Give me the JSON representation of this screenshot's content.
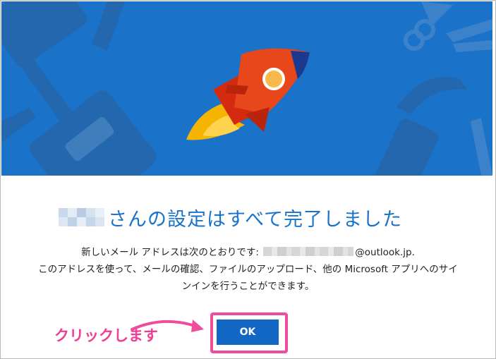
{
  "dialog": {
    "title": "さんの設定はすべて完了しました",
    "line1_prefix": "新しいメール アドレスは次のとおりです:",
    "email_domain": "@outlook.jp.",
    "line2": "このアドレスを使って、メールの確認、ファイルのアップロード、他の Microsoft アプリへのサイ",
    "line3": "ンインを行うことができます。",
    "ok_label": "OK"
  },
  "annotation": {
    "label": "クリックします",
    "color": "#ee4d9b"
  },
  "colors": {
    "hero_background": "#1a73c9",
    "title": "#1b73c9",
    "button": "#1367c4"
  },
  "icons": [
    "rocket-icon",
    "pencil-icon",
    "scissors-icon",
    "notebook-icon"
  ]
}
